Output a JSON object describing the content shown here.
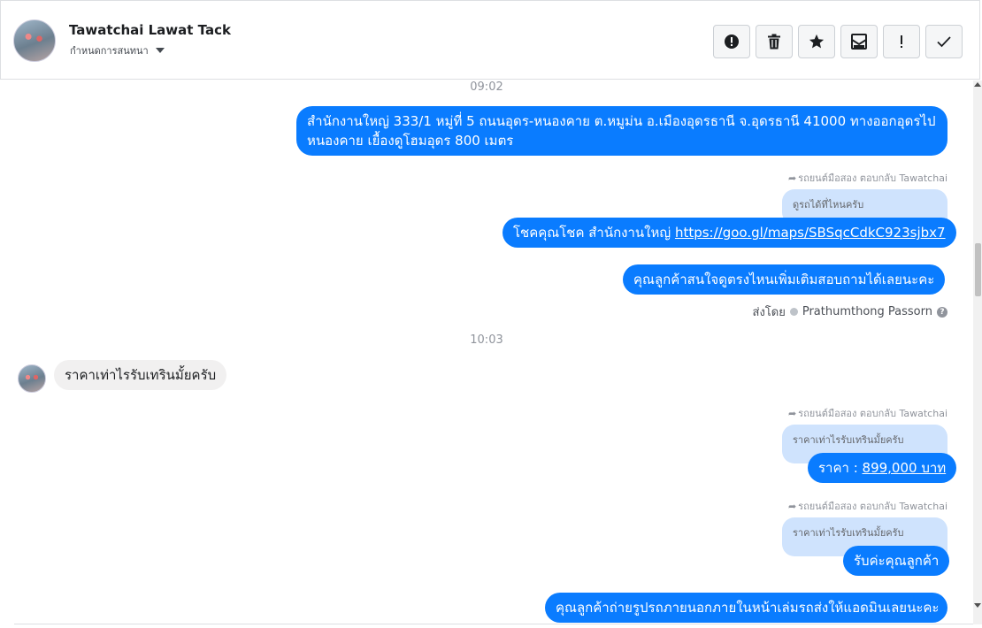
{
  "header": {
    "name": "Tawatchai Lawat Tack",
    "assign_label": "กำหนดการสนทนา",
    "toolbar": [
      {
        "icon": "alert-circle-icon",
        "name": "mark-spam-button"
      },
      {
        "icon": "trash-icon",
        "name": "delete-button"
      },
      {
        "icon": "star-icon",
        "name": "star-button"
      },
      {
        "icon": "mark-unread-icon",
        "name": "mark-unread-button"
      },
      {
        "icon": "exclamation-icon",
        "name": "follow-up-button"
      },
      {
        "icon": "check-icon",
        "name": "mark-done-button"
      }
    ]
  },
  "conversation": {
    "time1": "09:02",
    "msg1": "สำนักงานใหญ่ 333/1 หมู่ที่ 5 ถนนอุดร-หนองคาย ต.หมูม่น อ.เมืองอุดรธานี จ.อุดรธานี 41000 ทางออกอุดรไป หนองคาย เยื้องดูโฮมอุดร 800 เมตร",
    "reply_meta_1": "รถยนต์มือสอง ตอบกลับ Tawatchai",
    "quote1": "ดูรถได้ที่ไหนครับ",
    "msg2_text": "โชคคุณโชค สำนักงานใหญ่ ",
    "msg2_link": "https://goo.gl/maps/SBSqcCdkC923sjbx7",
    "msg3": "คุณลูกค้าสนใจดูตรงไหนเพิ่มเติมสอบถามได้เลยนะคะ",
    "sent_by_label": "ส่งโดย",
    "sent_by_name": "Prathumthong Passorn",
    "time2": "10:03",
    "incoming1": "ราคาเท่าไรรับเทรินมั้ยครับ",
    "reply_meta_2": "รถยนต์มือสอง ตอบกลับ Tawatchai",
    "quote2": "ราคาเท่าไรรับเทรินมั้ยครับ",
    "msg4_text": "ราคา : ",
    "msg4_link": "899,000 บาท",
    "reply_meta_3": "รถยนต์มือสอง ตอบกลับ Tawatchai",
    "quote3": "ราคาเท่าไรรับเทรินมั้ยครับ",
    "msg5": "รับค่ะคุณลูกค้า",
    "msg6": "คุณลูกค้าถ่ายรูปรถภายนอกภายในหน้าเล่มรถส่งให้แอดมินเลยนะคะ"
  },
  "colors": {
    "outgoing_bubble": "#0a7cff",
    "incoming_bubble": "#f1f0f0",
    "quote_bubble": "#cfe3fd"
  }
}
